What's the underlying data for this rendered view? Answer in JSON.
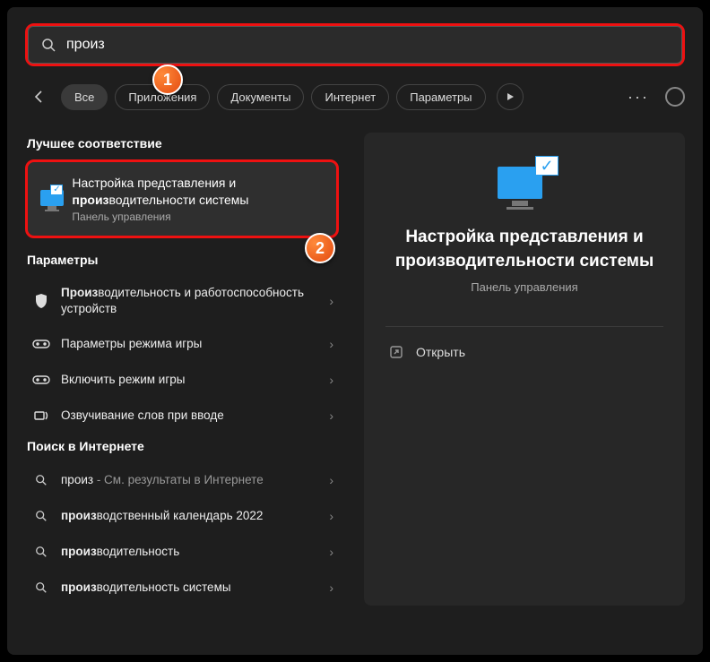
{
  "search": {
    "value": "произ"
  },
  "filters": {
    "all": "Все",
    "apps": "Приложения",
    "docs": "Документы",
    "web": "Интернет",
    "settings": "Параметры"
  },
  "sections": {
    "best": "Лучшее соответствие",
    "params": "Параметры",
    "web": "Поиск в Интернете"
  },
  "best_match": {
    "line1a": "Настройка представления и ",
    "line1b_hl": "произ",
    "line1c": "водительности системы",
    "sub": "Панель управления"
  },
  "params_results": [
    {
      "t_hl": "Произ",
      "t_rest": "водительность и работоспособность устройств",
      "icon": "shield"
    },
    {
      "t_pre": "Параметры режима игры",
      "icon": "gamepad"
    },
    {
      "t_pre": "Включить режим игры",
      "icon": "gamepad"
    },
    {
      "t_pre": "Озвучивание слов при вводе",
      "icon": "audio"
    }
  ],
  "web_results": [
    {
      "q": "произ",
      "tail": " - См. результаты в Интернете"
    },
    {
      "q_hl": "произ",
      "q_rest": "водственный календарь 2022"
    },
    {
      "q_hl": "произ",
      "q_rest": "водительность"
    },
    {
      "q_hl": "произ",
      "q_rest": "водительность системы"
    }
  ],
  "right_panel": {
    "title": "Настройка представления и производительности системы",
    "sub": "Панель управления",
    "open": "Открыть"
  },
  "callouts": {
    "one": "1",
    "two": "2"
  }
}
